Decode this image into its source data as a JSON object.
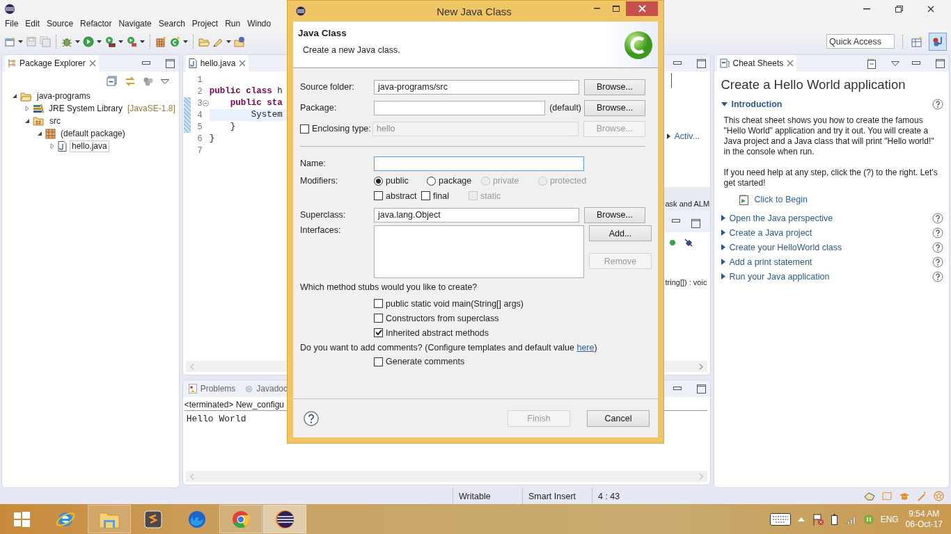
{
  "window": {
    "menu": [
      "File",
      "Edit",
      "Source",
      "Refactor",
      "Navigate",
      "Search",
      "Project",
      "Run",
      "Windo"
    ]
  },
  "toolbar": {
    "quick_access": {
      "placeholder": "Quick Access"
    }
  },
  "package_explorer": {
    "title": "Package Explorer",
    "tree": [
      {
        "label": "java-programs",
        "kind": "project",
        "expanded": true,
        "selected": false,
        "children": [
          {
            "label": "JRE System Library",
            "suffix": "[JavaSE-1.8]",
            "kind": "library",
            "expanded": false,
            "selected": false
          },
          {
            "label": "src",
            "kind": "folder",
            "expanded": true,
            "selected": false,
            "children": [
              {
                "label": "(default package)",
                "kind": "package",
                "expanded": true,
                "selected": false,
                "children": [
                  {
                    "label": "hello.java",
                    "kind": "file",
                    "expanded": false,
                    "selected": true
                  }
                ]
              }
            ]
          }
        ]
      }
    ]
  },
  "editor": {
    "tab": "hello.java",
    "lines": [
      {
        "number": "1",
        "changed": false,
        "current": false,
        "fold": false
      },
      {
        "number": "2",
        "changed": false,
        "current": false,
        "fold": false,
        "tokens": [
          {
            "text": "public class",
            "kind": "keyword"
          },
          {
            "text": " h",
            "kind": "plain"
          }
        ]
      },
      {
        "number": "3",
        "changed": true,
        "current": false,
        "fold": true,
        "tokens": [
          {
            "text": "    public sta",
            "kind": "keyword"
          }
        ]
      },
      {
        "number": "4",
        "changed": true,
        "current": true,
        "fold": false,
        "tokens": [
          {
            "text": "        System",
            "kind": "plain"
          }
        ]
      },
      {
        "number": "5",
        "changed": true,
        "current": false,
        "fold": false,
        "tokens": [
          {
            "text": "    }",
            "kind": "plain"
          }
        ]
      },
      {
        "number": "6",
        "changed": false,
        "current": false,
        "fold": false,
        "tokens": [
          {
            "text": "}",
            "kind": "plain"
          }
        ]
      },
      {
        "number": "7",
        "changed": false,
        "current": false,
        "fold": false
      }
    ]
  },
  "side_views": {
    "link": "Activ...",
    "task_text": "ask and ALM",
    "outline_text": "tring[]) : voic"
  },
  "console": {
    "tabs": [
      "Problems",
      "Javadoc"
    ],
    "header": "<terminated> New_configu",
    "output": "Hello World"
  },
  "cheat_sheet": {
    "tab": "Cheat Sheets",
    "title": "Create a Hello World application",
    "sections": [
      {
        "title": "Introduction",
        "expanded": true,
        "paragraphs": [
          "This cheat sheet shows you how to create the famous \"Hello World\" application and try it out. You will create a Java project and a Java class that will print \"Hello world!\" in the console when run.",
          "If you need help at any step, click the (?) to the right. Let's get started!"
        ],
        "action": "Click to Begin"
      },
      {
        "title": "Open the Java perspective",
        "expanded": false
      },
      {
        "title": "Create a Java project",
        "expanded": false
      },
      {
        "title": "Create your HelloWorld class",
        "expanded": false
      },
      {
        "title": "Add a print statement",
        "expanded": false
      },
      {
        "title": "Run your Java application",
        "expanded": false
      }
    ]
  },
  "status_bar": {
    "fields": [
      "Writable",
      "Smart Insert",
      "4 : 43"
    ]
  },
  "taskbar": {
    "apps": [
      {
        "kind": "ie",
        "running": false,
        "selected": false
      },
      {
        "kind": "explorer",
        "running": true,
        "selected": false
      },
      {
        "kind": "sublime",
        "running": false,
        "selected": false
      },
      {
        "kind": "firefox",
        "running": false,
        "selected": false
      },
      {
        "kind": "chrome",
        "running": true,
        "selected": false
      },
      {
        "kind": "eclipse",
        "running": true,
        "selected": true
      }
    ],
    "language": "ENG",
    "time": "9:54 AM",
    "date": "06-Oct-17"
  },
  "dialog": {
    "title": "New Java Class",
    "header_title": "Java Class",
    "header_message": "Create a new Java class.",
    "source_folder": {
      "label": "Source folder:",
      "value": "java-programs/src",
      "button": "Browse..."
    },
    "package": {
      "label": "Package:",
      "hint": "(default)",
      "button": "Browse..."
    },
    "enclosing_type": {
      "label": "Enclosing type:",
      "checked": false,
      "value": "hello",
      "button": "Browse...",
      "disabled": true
    },
    "name": {
      "label": "Name:",
      "focused": true
    },
    "modifiers": {
      "label": "Modifiers:",
      "access": [
        {
          "label": "public",
          "selected": true,
          "disabled": false
        },
        {
          "label": "package",
          "selected": false,
          "disabled": false
        },
        {
          "label": "private",
          "selected": false,
          "disabled": true
        },
        {
          "label": "protected",
          "selected": false,
          "disabled": true
        }
      ],
      "flags": [
        {
          "label": "abstract",
          "checked": false,
          "disabled": false
        },
        {
          "label": "final",
          "checked": false,
          "disabled": false
        },
        {
          "label": "static",
          "checked": false,
          "disabled": true
        }
      ]
    },
    "superclass": {
      "label": "Superclass:",
      "value": "java.lang.Object",
      "button": "Browse..."
    },
    "interfaces": {
      "label": "Interfaces:",
      "add_button": "Add...",
      "remove_button": "Remove",
      "remove_disabled": true
    },
    "stubs": {
      "question": "Which method stubs would you like to create?",
      "options": [
        {
          "label": "public static void main(String[] args)",
          "checked": false
        },
        {
          "label": "Constructors from superclass",
          "checked": false
        },
        {
          "label": "Inherited abstract methods",
          "checked": true
        }
      ]
    },
    "comments": {
      "question": "Do you want to add comments? (Configure templates and default value ",
      "link": "here",
      "closing": ")",
      "options": [
        {
          "label": "Generate comments",
          "checked": false
        }
      ]
    },
    "buttons": [
      {
        "label": "Finish",
        "disabled": true
      },
      {
        "label": "Cancel",
        "disabled": false
      }
    ]
  }
}
